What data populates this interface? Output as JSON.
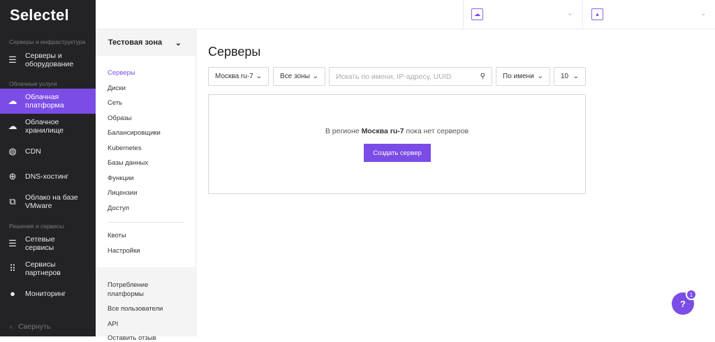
{
  "brand": "Selectel",
  "sidebar": {
    "sections": [
      "Серверы и инфраструктура",
      "Облачные услуги",
      "Решения и сервисы"
    ],
    "items": [
      {
        "label": "Серверы и оборудование"
      },
      {
        "label": "Облачная платформа"
      },
      {
        "label": "Облачное хранилище"
      },
      {
        "label": "CDN"
      },
      {
        "label": "DNS-хостинг"
      },
      {
        "label": "Облако на базе VMware"
      },
      {
        "label": "Сетевые сервисы"
      },
      {
        "label": "Сервисы партнеров"
      },
      {
        "label": "Мониторинг"
      }
    ],
    "collapse": "Свернуть"
  },
  "submenu": {
    "zone": "Тестовая зона",
    "items": [
      "Серверы",
      "Диски",
      "Сеть",
      "Образы",
      "Балансировщики",
      "Kubernetes",
      "Базы данных",
      "Функции",
      "Лицензии",
      "Доступ"
    ],
    "items2": [
      "Квоты",
      "Настройки"
    ],
    "footer": [
      "Потребление платформы",
      "Все пользователи",
      "API",
      "Оставить отзыв"
    ]
  },
  "main": {
    "title": "Серверы",
    "region": "Москва ru-7",
    "zones": "Все зоны",
    "search_placeholder": "Искать по имени, IP-адресу, UUID",
    "sort": "По имени",
    "per_page": "10",
    "empty_pre": "В регионе ",
    "empty_region": "Москва ru-7",
    "empty_post": " пока нет серверов",
    "create_button": "Создать сервер"
  },
  "help": {
    "label": "?",
    "badge": "1"
  },
  "colors": {
    "accent": "#7b4ce6",
    "sidebar": "#232326"
  }
}
